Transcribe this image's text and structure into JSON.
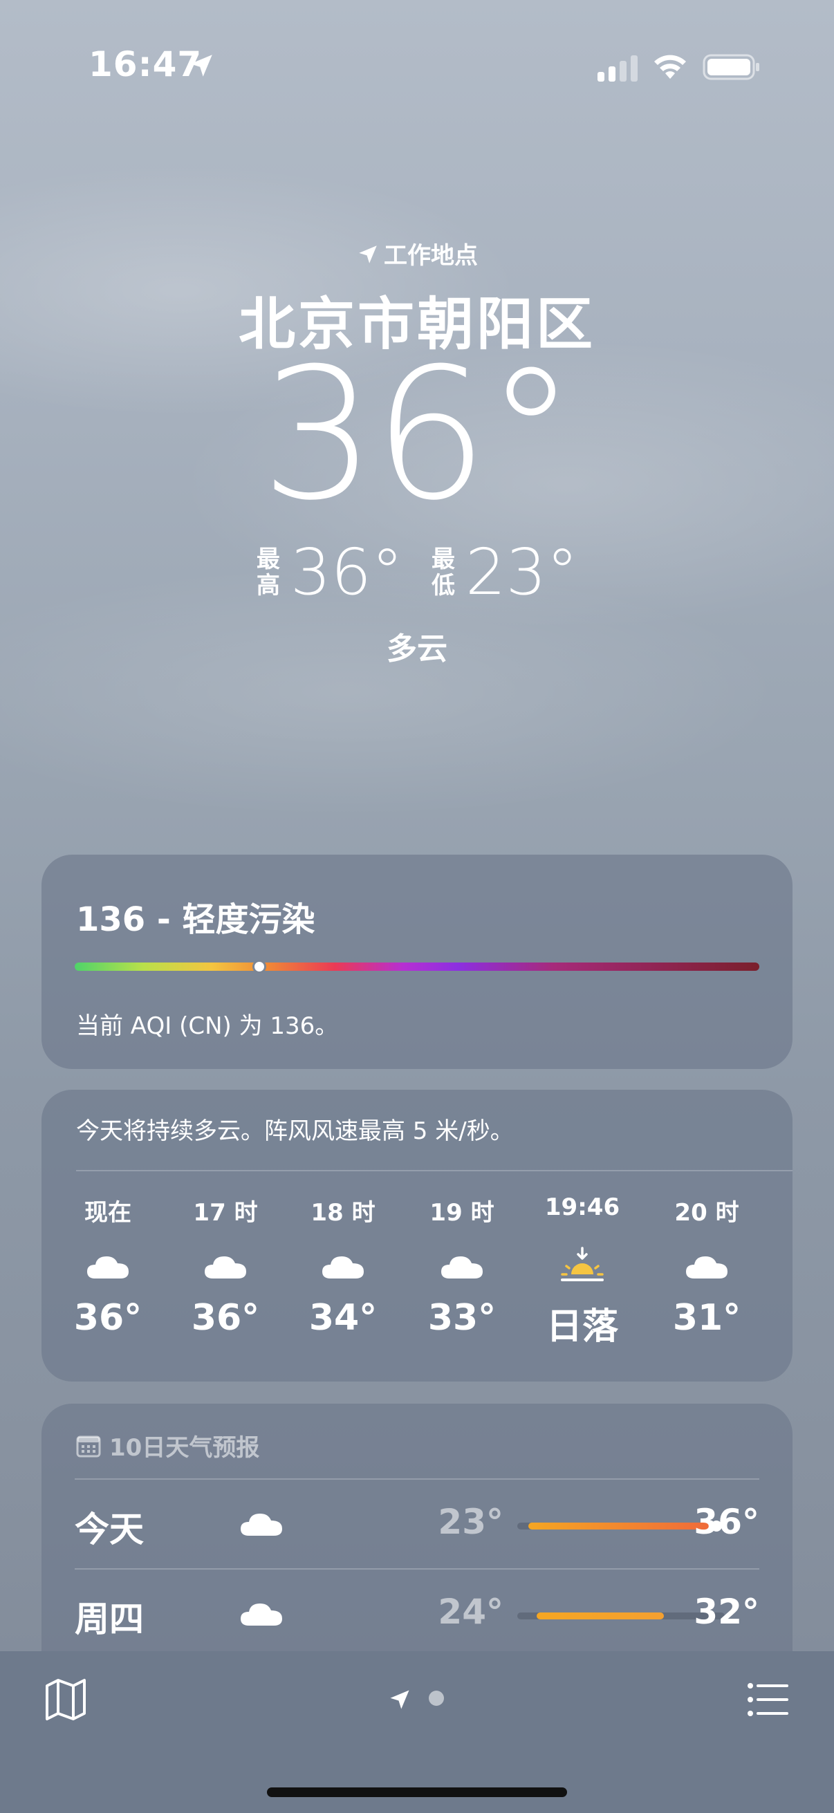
{
  "status_bar": {
    "time": "16:47",
    "icons": [
      "location-arrow-icon",
      "cellular-signal-icon",
      "wifi-icon",
      "battery-icon"
    ]
  },
  "header": {
    "location_tag": "工作地点",
    "city": "北京市朝阳区",
    "current_temp": "36°",
    "high_label": "最高",
    "high_value": "36°",
    "low_label": "最低",
    "low_value": "23°",
    "condition": "多云"
  },
  "aqi": {
    "title": "136 - 轻度污染",
    "description": "当前 AQI (CN) 为 136。",
    "level_fraction": 0.27
  },
  "hourly": {
    "summary": "今天将持续多云。阵风风速最高 5 米/秒。",
    "items": [
      {
        "label": "现在",
        "icon": "cloud-icon",
        "value": "36°"
      },
      {
        "label": "17 时",
        "icon": "cloud-icon",
        "value": "36°"
      },
      {
        "label": "18 时",
        "icon": "cloud-icon",
        "value": "34°"
      },
      {
        "label": "19 时",
        "icon": "cloud-icon",
        "value": "33°"
      },
      {
        "label": "19:46",
        "icon": "sunset-icon",
        "value": "日落"
      },
      {
        "label": "20 时",
        "icon": "cloud-icon",
        "value": "31°"
      }
    ]
  },
  "daily": {
    "header": "10日天气预报",
    "days": [
      {
        "name": "今天",
        "icon": "cloud-icon",
        "low": "23°",
        "high": "36°"
      },
      {
        "name": "周四",
        "icon": "cloud-icon",
        "low": "24°",
        "high": "32°"
      }
    ]
  },
  "bottom_bar": {
    "icons": [
      "map-icon",
      "location-arrow-icon",
      "page-dot",
      "list-icon"
    ]
  },
  "colors": {
    "card_bg": "#6c788a",
    "sunset_yellow": "#f5c542",
    "temp_bar_orange": "#f5a623",
    "temp_bar_red": "#ef6a3a"
  }
}
